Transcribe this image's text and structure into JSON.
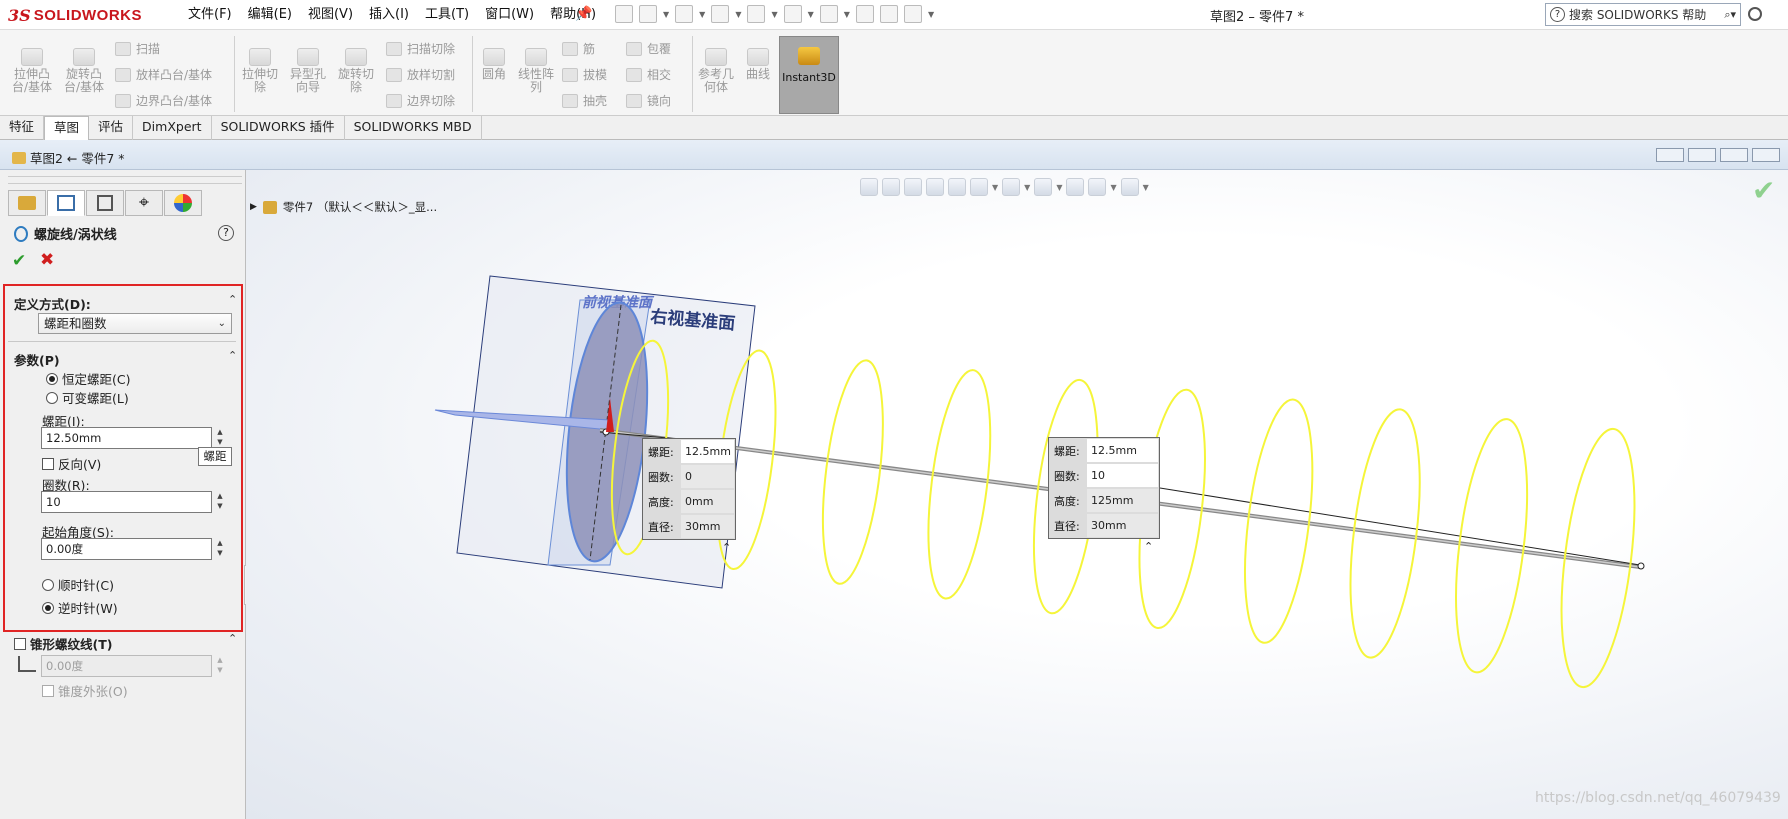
{
  "app": {
    "logo_ds": "3S",
    "logo_text": "SOLIDWORKS",
    "doc_title": "草图2 – 零件7 *"
  },
  "menu": [
    "文件(F)",
    "编辑(E)",
    "视图(V)",
    "插入(I)",
    "工具(T)",
    "窗口(W)",
    "帮助(H)"
  ],
  "help_search": {
    "placeholder": "搜索 SOLIDWORKS 帮助"
  },
  "ribbon": {
    "extrude_boss": "拉伸凸\n台/基体",
    "revolve_boss": "旋转凸\n台/基体",
    "sweep": "扫描",
    "loft_boss": "放样凸台/基体",
    "boundary_boss": "边界凸台/基体",
    "extrude_cut": "拉伸切\n除",
    "hole_wizard": "异型孔\n向导",
    "revolve_cut": "旋转切\n除",
    "sweep_cut": "扫描切除",
    "loft_cut": "放样切割",
    "boundary_cut": "边界切除",
    "fillet": "圆角",
    "linear_pattern": "线性阵\n列",
    "rib": "筋",
    "draft": "拔模",
    "shell": "抽壳",
    "wrap": "包覆",
    "intersect": "相交",
    "mirror": "镜向",
    "ref_geometry": "参考几\n何体",
    "curves": "曲线",
    "instant3d": "Instant3D"
  },
  "command_tabs": [
    "特征",
    "草图",
    "评估",
    "DimXpert",
    "SOLIDWORKS 插件",
    "SOLIDWORKS MBD"
  ],
  "sketch_header": {
    "title": "草图2 ← 零件7 *"
  },
  "property_manager": {
    "title": "螺旋线/涡状线",
    "help": "?",
    "ok": "✔",
    "cancel": "✖",
    "define_by": {
      "label": "定义方式(D):",
      "value": "螺距和圈数"
    },
    "parameters": {
      "label": "参数(P)",
      "constant_pitch": "恒定螺距(C)",
      "variable_pitch": "可变螺距(L)",
      "pitch_label": "螺距(I):",
      "pitch_value": "12.50mm",
      "reverse": "反向(V)",
      "revolutions_label": "圈数(R):",
      "revolutions_value": "10",
      "start_angle_label": "起始角度(S):",
      "start_angle_value": "0.00度",
      "clockwise": "顺时针(C)",
      "counterclockwise": "逆时针(W)",
      "selected_direction": "counterclockwise",
      "selected_pitch_mode": "constant"
    },
    "taper": {
      "label": "锥形螺纹线(T)",
      "angle_value": "0.00度",
      "taper_outward": "锥度外张(O)"
    },
    "tooltip": "螺距"
  },
  "feature_tree": {
    "label": "零件7 （默认＜＜默认＞_显..."
  },
  "viewport": {
    "front_plane_label": "前视基准面",
    "right_plane_label": "右视基准面",
    "helix_color": "#f5f53a",
    "callout_start": [
      {
        "key": "螺距:",
        "value": "12.5mm"
      },
      {
        "key": "圈数:",
        "value": "0"
      },
      {
        "key": "高度:",
        "value": "0mm"
      },
      {
        "key": "直径:",
        "value": "30mm"
      }
    ],
    "callout_end": [
      {
        "key": "螺距:",
        "value": "12.5mm"
      },
      {
        "key": "圈数:",
        "value": "10"
      },
      {
        "key": "高度:",
        "value": "125mm"
      },
      {
        "key": "直径:",
        "value": "30mm"
      }
    ]
  },
  "watermark": "https://blog.csdn.net/qq_46079439"
}
